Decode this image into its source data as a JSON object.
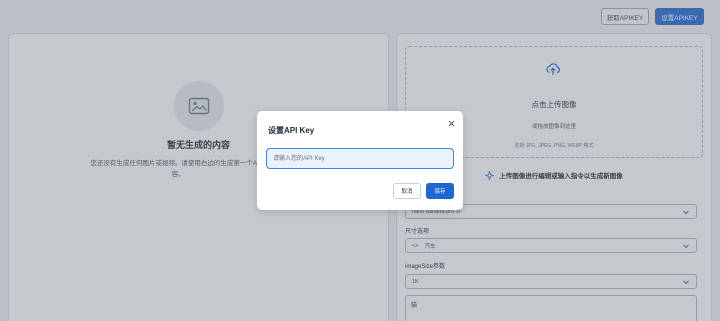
{
  "header": {
    "get_apikey_label": "获取APIKEY",
    "set_apikey_label": "设置APIKEY"
  },
  "left_panel": {
    "empty_icon": "image-icon",
    "empty_title": "暂无生成的内容",
    "empty_description": "您还没有生成任何图片或视频。请使用右边的生成第一个AI内容。"
  },
  "right_panel": {
    "upload": {
      "icon": "upload-cloud-icon",
      "title": "点击上传图像",
      "subtitle": "或拖放图像到这里",
      "formats": "支持 JPG, JPEG, PNG, WEBP 格式"
    },
    "hint": {
      "icon": "sparkle-icon",
      "text": "上传图像进行编辑或输入指令以生成新图像"
    },
    "model_select": {
      "value": "nano-banana-pro-vt"
    },
    "size_label": "尺寸选项",
    "size_select": {
      "icon": "resize-icon",
      "value": "汽车"
    },
    "imagesize_label": "imageSize参数",
    "imagesize_select": {
      "value": "1K"
    },
    "prompt_textarea": {
      "value": "猫"
    }
  },
  "modal": {
    "title": "设置API Key",
    "close_icon": "close-icon",
    "input_placeholder": "请输入您的API Key",
    "input_value": "",
    "cancel_label": "取消",
    "save_label": "保存"
  },
  "colors": {
    "primary": "#1e66d0",
    "input_focus_border": "#3b82f6",
    "page_background": "#e9ecf0"
  }
}
